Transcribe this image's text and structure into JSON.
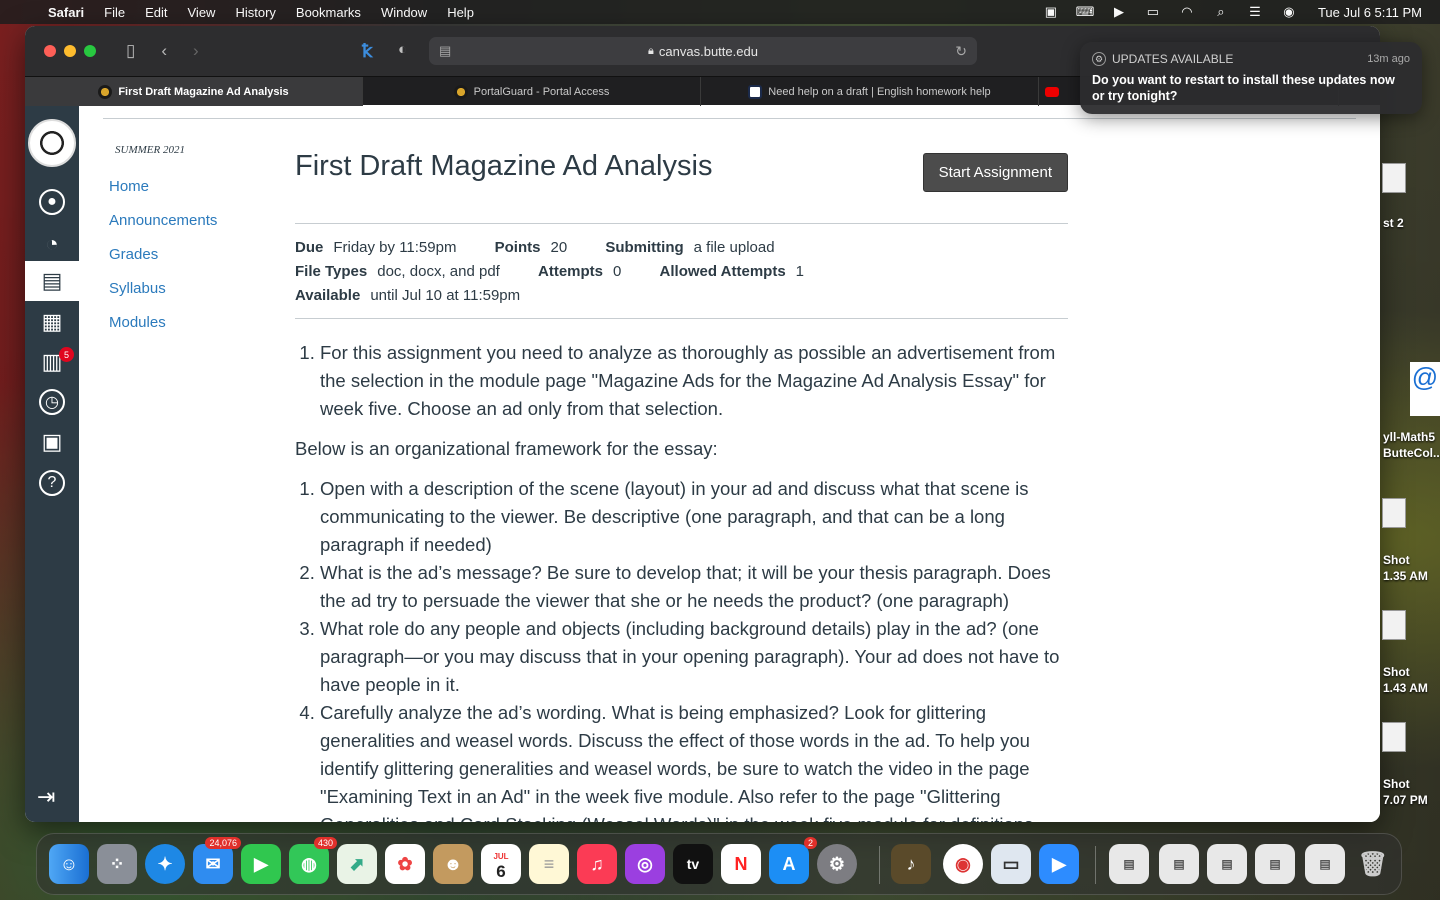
{
  "menubar": {
    "app": "Safari",
    "items": [
      "File",
      "Edit",
      "View",
      "History",
      "Bookmarks",
      "Window",
      "Help"
    ],
    "datetime": "Tue Jul 6  5:11 PM"
  },
  "browser": {
    "url": "canvas.butte.edu",
    "tabs": [
      {
        "label": "First Draft Magazine Ad Analysis"
      },
      {
        "label": "PortalGuard - Portal Access"
      },
      {
        "label": "Need help on a draft | English homework help"
      }
    ]
  },
  "notification": {
    "title": "UPDATES AVAILABLE",
    "time": "13m ago",
    "message": "Do you want to restart to install these updates now or try tonight?"
  },
  "globalnav": {
    "inbox_badge": "5"
  },
  "course_nav": {
    "term": "SUMMER 2021",
    "links": [
      "Home",
      "Announcements",
      "Grades",
      "Syllabus",
      "Modules"
    ]
  },
  "assignment": {
    "title": "First Draft Magazine Ad Analysis",
    "start_button": "Start Assignment",
    "due_label": "Due",
    "due": "Friday by 11:59pm",
    "points_label": "Points",
    "points": "20",
    "submitting_label": "Submitting",
    "submitting": "a file upload",
    "file_types_label": "File Types",
    "file_types": "doc, docx, and pdf",
    "attempts_label": "Attempts",
    "attempts": "0",
    "allowed_label": "Allowed Attempts",
    "allowed": "1",
    "available_label": "Available",
    "available": "until Jul 10 at 11:59pm",
    "intro_item": "For this assignment you need to analyze as thoroughly as possible an advertisement from the selection in the module page \"Magazine Ads for the Magazine Ad Analysis Essay\" for week five.  Choose an ad only from that selection.",
    "framework_intro": "Below is an organizational framework for the essay:",
    "framework": [
      "Open with a description of the scene (layout) in your ad and discuss what that scene is communicating to the viewer.  Be descriptive (one paragraph, and that can be a long paragraph if needed)",
      " What is the ad’s message? Be sure to develop that; it will be your thesis paragraph. Does the ad try to persuade the viewer that she or he needs the product? (one paragraph)",
      "What role do any people and objects (including background details) play in the ad? (one paragraph—or you may discuss that in your opening paragraph).  Your ad does not have to have people in it.",
      "Carefully analyze the ad’s wording. What is being emphasized? Look for glittering generalities and weasel words.  Discuss the effect of those words in the ad. To help you identify glittering generalities and weasel words, be sure to watch the video in the page \"Examining Text in an Ad\" in the week five module.  Also refer to the page \"Glittering Generalities and Card Stacking (Weasel Words)\" in the week five module for definitions"
    ]
  },
  "desktop": {
    "labels": [
      "st 2",
      "yll-Math5",
      "ButteCol...",
      "Shot",
      "1.35 AM",
      "Shot",
      "1.43 AM",
      "Shot",
      "7.07 PM"
    ]
  },
  "dock": {
    "mail_badge": "24,076",
    "messages_badge": "430",
    "calendar_month": "JUL",
    "calendar_day": "6",
    "appstore_badge": "2",
    "tv_label": "tv"
  }
}
